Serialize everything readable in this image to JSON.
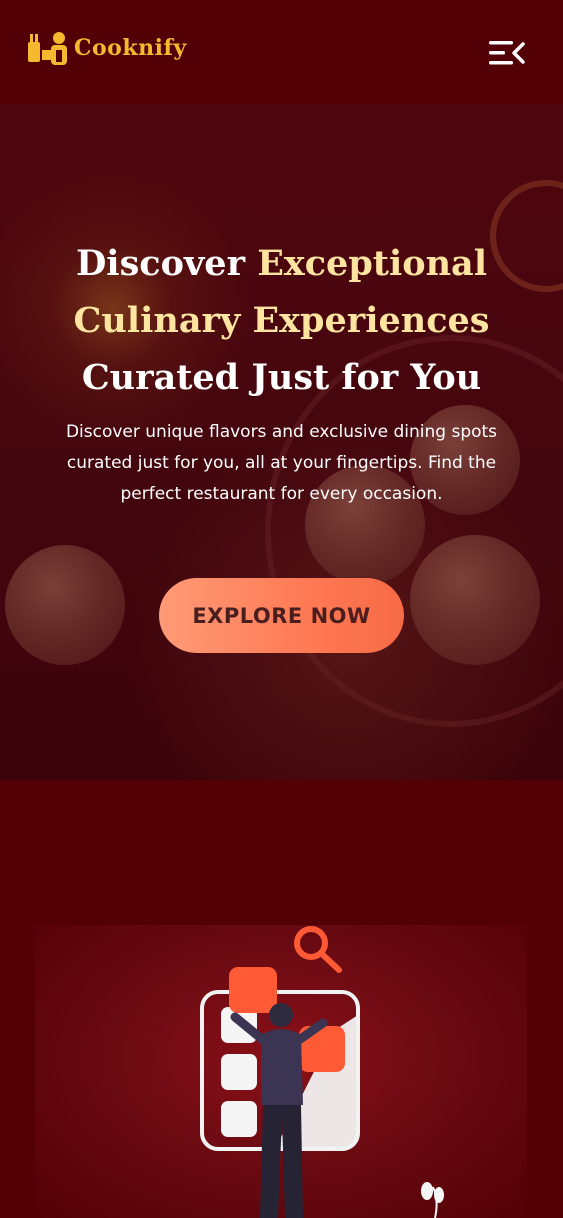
{
  "header": {
    "logo_text": "Cooknify",
    "menu_icon": "menu-collapse-icon"
  },
  "hero": {
    "title_line1_plain": "Discover ",
    "title_line1_highlight": "Exceptional",
    "title_line2_highlight": "Culinary Experiences",
    "title_line3_plain": "Curated Just for You",
    "description": "Discover unique flavors and exclusive dining spots curated just for you, all at your fingertips. Find the perfect restaurant for every occasion.",
    "cta_label": "EXPLORE NOW"
  },
  "illustration": {
    "icon": "search-icon"
  },
  "colors": {
    "background": "#520005",
    "logo": "#f5b82e",
    "highlight": "#fde5a1",
    "cta": "#ff7a55",
    "accent": "#ff5a36"
  }
}
